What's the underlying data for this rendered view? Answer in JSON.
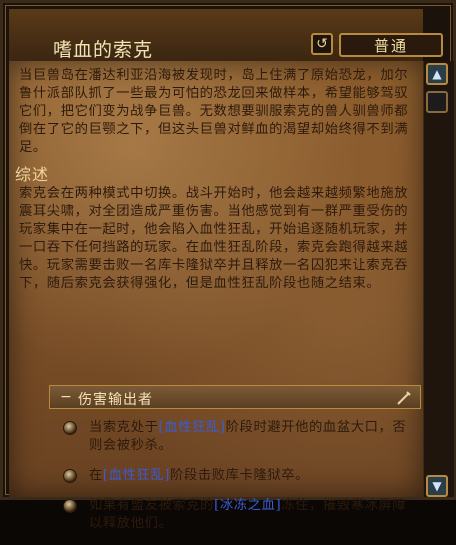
{
  "header": {
    "title": "嗜血的索克",
    "reset_icon": "↺",
    "difficulty_label": "普通"
  },
  "content": {
    "intro": "当巨兽岛在潘达利亚沿海被发现时，岛上住满了原始恐龙，加尔鲁什派部队抓了一些最为可怕的恐龙回来做样本，希望能够驾驭它们，把它们变为战争巨兽。无数想要驯服索克的兽人驯兽师都倒在了它的巨颚之下，但这头巨兽对鲜血的渴望却始终得不到满足。",
    "overview_title": "综述",
    "overview": "索克会在两种模式中切换。战斗开始时，他会越来越频繁地施放震耳尖啸，对全团造成严重伤害。当他感觉到有一群严重受伤的玩家集中在一起时，他会陷入血性狂乱，开始追逐随机玩家，并一口吞下任何挡路的玩家。在血性狂乱阶段，索克会跑得越来越快。玩家需要击败一名库卡隆狱卒并且释放一名囚犯来让索克吞下，随后索克会获得强化，但是血性狂乱阶段也随之结束。",
    "section_label": "伤害输出者",
    "bullets": [
      {
        "pre": "当索克处于",
        "link": "[血性狂乱]",
        "post": "阶段时避开他的血盆大口，否则会被秒杀。"
      },
      {
        "pre": "在",
        "link": "[血性狂乱]",
        "post": "阶段击败库卡隆狱卒。"
      },
      {
        "pre": "如果有盟友被索克的",
        "link": "[冰冻之血]",
        "post": "冻住，摧毁寒冰屏障以释放他们。"
      }
    ]
  },
  "colors": {
    "parchment": "#7a4d26",
    "text": "#2e1a0c",
    "link": "#3b5bd6",
    "accent_gold": "#b88a3e"
  },
  "icons": {
    "reset": "reset-icon",
    "collapse": "minus-icon",
    "sword": "sword-icon",
    "scroll_up": "scroll-up-icon",
    "scroll_down": "scroll-down-icon"
  }
}
